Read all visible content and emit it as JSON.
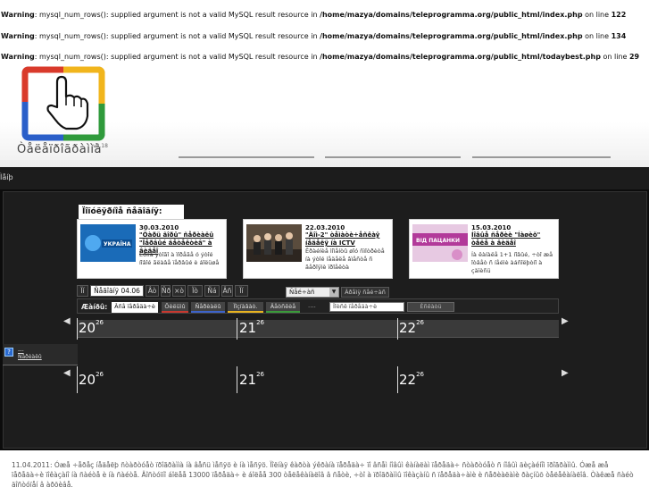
{
  "warnings": [
    {
      "label": "Warning",
      "msg": ": mysql_num_rows(): supplied argument is not a valid MySQL result resource in ",
      "path": "/home/mazya/domains/teleprogramma.org/public_html/index.php",
      "line_pre": " on line ",
      "line": "122"
    },
    {
      "label": "Warning",
      "msg": ": mysql_num_rows(): supplied argument is not a valid MySQL result resource in ",
      "path": "/home/mazya/domains/teleprogramma.org/public_html/index.php",
      "line_pre": " on line ",
      "line": "134"
    },
    {
      "label": "Warning",
      "msg": ": mysql_num_rows(): supplied argument is not a valid MySQL result resource in ",
      "path": "/home/mazya/domains/teleprogramma.org/public_html/todaybest.php",
      "line_pre": " on line ",
      "line": "29"
    }
  ],
  "site": {
    "name": "Òåëåïðîãðàììà",
    "version": "v0.18"
  },
  "nav": {
    "label": "Ìåíþ"
  },
  "popular": {
    "title": "Ïîïóëÿðíîå ñåãîäíÿ:",
    "cards": [
      {
        "date": "30.03.2010",
        "title": "\"Öàðü ãîðû\" ñåðèàëû \"Ïåðâûé äåòåêòèâ\" à âèäåî",
        "desc": "Êðîìå ýòîãî à ìîðåãå ó ýòîé íîâîé ãëàâå ïåðâûé è áîëüøå",
        "thumb_label": "УКРАЇНА"
      },
      {
        "date": "22.03.2010",
        "title": "\"Äîì-2\" òåìàòè÷åñêàÿ íåäåëÿ íà ICTV",
        "desc": "Êðàéíèå ìîìåíòû øîó ñìîòðèòå íà ýòîé íåäåëå âìåñòå ñ ãåðîÿìè ïðîåêòà",
        "thumb_label": ""
      },
      {
        "date": "15.03.2010",
        "title": "Íîâûå ñåðèè \"Íàøèõ\" òåëå à âèäåî",
        "desc": "Íà êàíàëå 1+1 íîâûé, ÷òî æå îòâåò ñ íåéìè àáñîëþòíî à çàïèñü",
        "thumb_label": "ВІД ПАЦАНКИ"
      }
    ]
  },
  "days": [
    "Ïí",
    "Ñåãîäíÿ 04.06",
    "Âò",
    "Ñð",
    "×ò",
    "Ïò",
    "Ñá",
    "Âñ",
    "Ïí"
  ],
  "time_select": {
    "value": "Ñåé÷àñ",
    "arrow": "▼"
  },
  "now_button": "Âðåìÿ ñåé÷àñ",
  "genres": {
    "label": "Æàíðû:",
    "items": [
      {
        "label": "Âñå ïåðåäà÷è",
        "color": "#ffffff"
      },
      {
        "label": "Ôèëüìû",
        "color": "#c8382f"
      },
      {
        "label": "Ñåðèàëû",
        "color": "#3d63c9"
      },
      {
        "label": "Ïîçíàâàò.",
        "color": "#e8b320"
      },
      {
        "label": "Äåòñêèå",
        "color": "#3a9a3a"
      }
    ],
    "more": "....",
    "search_placeholder": "Ïîèñê ïåðåäà÷è",
    "search_button": "Èñêàòü"
  },
  "timeline": {
    "ticks": [
      {
        "hour": "20",
        "min": "26"
      },
      {
        "hour": "21",
        "min": "26"
      },
      {
        "hour": "22",
        "min": "26"
      }
    ],
    "prev_arrow": "◀",
    "next_arrow": "▶"
  },
  "channel": {
    "icon": "?",
    "label_line1": "---",
    "label_line2": "Ñåðèàëû"
  },
  "footer": "11.04.2011: Óæå ÷åðåç íåäåëþ ñòàðòóåò ïðîãðàììà íà âåñü ìåñÿö è íà ìåñÿö. Ïîëíàÿ êàðòà ýêðàíà ïåðåäà÷ ïî âñåì íîâûì êàíàëàì ïåðåäà÷ ñòàðòóåò ñ íîâûì äèçàéíîì ïðîãðàììû. Óæå æå ïåðåäà÷è ïîêàçàíî íà ñàéòå è íà ñàéòå. Äîñòóïíî áîëåå 13000 ïåðåäà÷ è áîëåå 300 òåëåêàíàëîâ â ñåòè, ÷òî à ïðîãðàììû ïîêàçàíû ñ ïåðåäà÷àìè è ñåðèàëàìè ðàçíûõ òåëåêàíàëîâ. Òàêæå ñàéò äîñòóïåí â àðõèâå."
}
